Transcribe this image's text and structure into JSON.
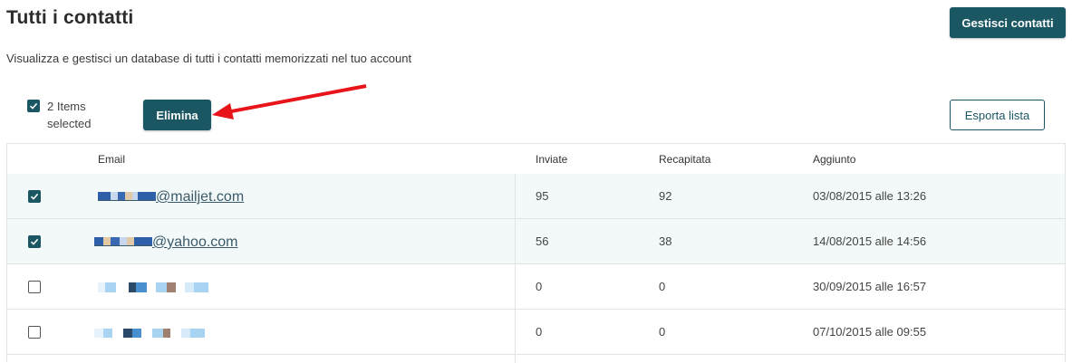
{
  "header": {
    "title": "Tutti i contatti",
    "subtitle": "Visualizza e gestisci un database di tutti i contatti memorizzati nel tuo account",
    "manage_button": "Gestisci contatti"
  },
  "toolbar": {
    "selection_text": "2 Items selected",
    "delete_button": "Elimina",
    "export_button": "Esporta lista"
  },
  "table": {
    "columns": [
      "Email",
      "Inviate",
      "Recapitata",
      "Aggiunto"
    ],
    "rows": [
      {
        "email_domain": "@mailjet.com",
        "sent": "95",
        "delivered": "92",
        "added": "03/08/2015 alle 13:26",
        "checked": true
      },
      {
        "email_domain": "@yahoo.com",
        "sent": "56",
        "delivered": "38",
        "added": "14/08/2015 alle 14:56",
        "checked": true
      },
      {
        "email_domain": "",
        "sent": "0",
        "delivered": "0",
        "added": "30/09/2015 alle 16:57",
        "checked": false
      },
      {
        "email_domain": "",
        "sent": "0",
        "delivered": "0",
        "added": "07/10/2015 alle 09:55",
        "checked": false
      }
    ]
  },
  "colors": {
    "primary": "#1b5663",
    "selected_row": "#f3f9f9",
    "annotation_arrow": "#e8141a"
  }
}
